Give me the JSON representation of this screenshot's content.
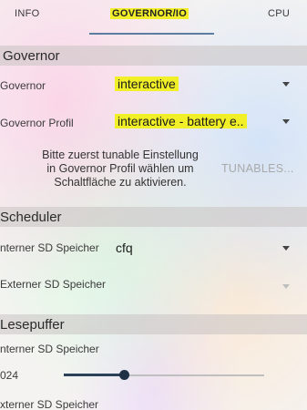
{
  "tabs": [
    {
      "label": "INFO"
    },
    {
      "label": "GOVERNOR/IO"
    },
    {
      "label": "CPU"
    }
  ],
  "governor": {
    "header": "Governor",
    "governor_label": "Governor",
    "governor_value": "interactive",
    "profile_label": "Governor Profil",
    "profile_value": "interactive - battery e..",
    "hint_lines": [
      "Bitte zuerst tunable Einstellung",
      "in Governor Profil wählen um",
      "Schaltfläche zu aktivieren."
    ],
    "tunables_button": "TUNABLES..."
  },
  "scheduler": {
    "header": "Scheduler",
    "internal_label": "nterner SD Speicher",
    "internal_value": "cfq",
    "external_label": "Externer SD Speicher",
    "external_value": ""
  },
  "readahead": {
    "header": "Lesepuffer",
    "internal_label": "nterner SD Speicher",
    "internal_value": "024",
    "slider_fraction": 0.3,
    "external_label": "xterner SD Speicher"
  },
  "colors": {
    "highlight": "#f1ef27",
    "accent": "#2b4158"
  }
}
